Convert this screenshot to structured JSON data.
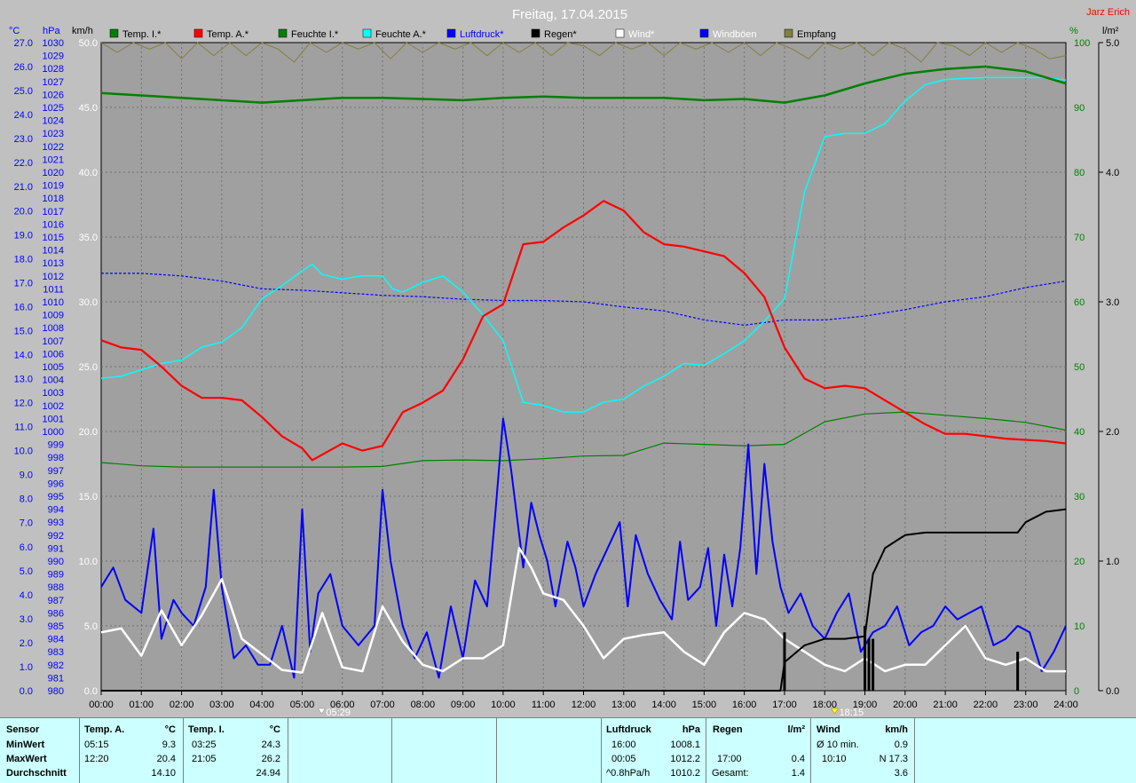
{
  "title": "Freitag, 17.04.2015",
  "author": "Jarz Erich",
  "legend": [
    {
      "label": "Temp. I.*",
      "color": "#008000",
      "text_color": "#000000"
    },
    {
      "label": "Temp. A.*",
      "color": "#ff0000",
      "text_color": "#000000"
    },
    {
      "label": "Feuchte I.*",
      "color": "#008000",
      "text_color": "#000000"
    },
    {
      "label": "Feuchte A.*",
      "color": "#00ffff",
      "text_color": "#000000"
    },
    {
      "label": "Luftdruck*",
      "color": "#0000ff",
      "text_color": "#0000ff"
    },
    {
      "label": "Regen*",
      "color": "#000000",
      "text_color": "#000000"
    },
    {
      "label": "Wind*",
      "color": "#ffffff",
      "text_color": "#ffffff"
    },
    {
      "label": "Windböen",
      "color": "#0000ff",
      "text_color": "#ffffff"
    },
    {
      "label": "Empfang",
      "color": "#808040",
      "text_color": "#000000"
    }
  ],
  "axis_units": {
    "celsius": "°C",
    "hpa": "hPa",
    "kmh": "km/h",
    "percent": "%",
    "rain": "l/m²"
  },
  "axes": {
    "celsius": [
      "27.0",
      "26.0",
      "25.0",
      "24.0",
      "23.0",
      "22.0",
      "21.0",
      "20.0",
      "19.0",
      "18.0",
      "17.0",
      "16.0",
      "15.0",
      "14.0",
      "13.0",
      "12.0",
      "11.0",
      "10.0",
      "9.0",
      "8.0",
      "7.0",
      "6.0",
      "5.0",
      "4.0",
      "3.0",
      "2.0",
      "1.0",
      "0.0"
    ],
    "hpa": [
      "1030",
      "1029",
      "1028",
      "1027",
      "1026",
      "1025",
      "1024",
      "1023",
      "1022",
      "1021",
      "1020",
      "1019",
      "1018",
      "1017",
      "1016",
      "1015",
      "1014",
      "1013",
      "1012",
      "1011",
      "1010",
      "1009",
      "1008",
      "1007",
      "1006",
      "1005",
      "1004",
      "1003",
      "1002",
      "1001",
      "1000",
      "999",
      "998",
      "997",
      "996",
      "995",
      "994",
      "993",
      "992",
      "991",
      "990",
      "989",
      "988",
      "987",
      "986",
      "985",
      "984",
      "983",
      "982",
      "981",
      "980"
    ],
    "kmh": [
      "50.0",
      "45.0",
      "40.0",
      "35.0",
      "30.0",
      "25.0",
      "20.0",
      "15.0",
      "10.0",
      "5.0",
      "0.0"
    ],
    "percent": [
      "100",
      "90",
      "80",
      "70",
      "60",
      "50",
      "40",
      "30",
      "20",
      "10",
      "0"
    ],
    "rain": [
      "5.0",
      "4.0",
      "3.0",
      "2.0",
      "1.0",
      "0.0"
    ],
    "time": [
      "00:00",
      "01:00",
      "02:00",
      "03:00",
      "04:00",
      "05:00",
      "06:00",
      "07:00",
      "08:00",
      "09:00",
      "10:00",
      "11:00",
      "12:00",
      "13:00",
      "14:00",
      "15:00",
      "16:00",
      "17:00",
      "18:00",
      "19:00",
      "20:00",
      "21:00",
      "22:00",
      "23:00",
      "24:00"
    ]
  },
  "sunrise": "05:29",
  "sunset": "18:15",
  "chart_data": {
    "type": "line",
    "x_unit": "hours",
    "xlim": [
      0,
      24
    ],
    "series": [
      {
        "name": "Temp. I.*",
        "axis": "°C",
        "color": "#008000",
        "x": [
          0,
          1,
          2,
          3,
          4,
          5,
          6,
          7,
          8,
          9,
          10,
          11,
          12,
          13,
          14,
          15,
          16,
          17,
          18,
          19,
          20,
          21,
          22,
          23,
          24
        ],
        "y": [
          24.9,
          24.8,
          24.7,
          24.6,
          24.5,
          24.6,
          24.7,
          24.7,
          24.65,
          24.6,
          24.7,
          24.75,
          24.7,
          24.7,
          24.7,
          24.6,
          24.65,
          24.5,
          24.8,
          25.3,
          25.7,
          25.9,
          26.0,
          25.8,
          25.3
        ]
      },
      {
        "name": "Temp. A.*",
        "axis": "°C",
        "color": "#ff0000",
        "x": [
          0,
          0.5,
          1,
          1.5,
          2,
          2.5,
          3,
          3.5,
          4,
          4.5,
          5,
          5.25,
          6,
          6.5,
          7,
          7.5,
          8,
          8.5,
          9,
          9.5,
          10,
          10.5,
          11,
          11.5,
          12,
          12.5,
          13,
          13.5,
          14,
          14.5,
          15,
          15.5,
          16,
          16.5,
          17,
          17.5,
          18,
          18.5,
          19,
          19.5,
          20,
          20.5,
          21,
          21.5,
          22,
          22.5,
          23,
          23.5,
          24
        ],
        "y": [
          14.6,
          14.3,
          14.2,
          13.5,
          12.7,
          12.2,
          12.2,
          12.1,
          11.4,
          10.6,
          10.1,
          9.6,
          10.3,
          10.0,
          10.2,
          11.6,
          12.0,
          12.5,
          13.8,
          15.6,
          16.1,
          18.6,
          18.7,
          19.3,
          19.8,
          20.4,
          20.0,
          19.1,
          18.6,
          18.5,
          18.3,
          18.1,
          17.4,
          16.4,
          14.3,
          13.0,
          12.6,
          12.7,
          12.6,
          12.1,
          11.6,
          11.1,
          10.7,
          10.7,
          10.6,
          10.5,
          10.45,
          10.4,
          10.3
        ]
      },
      {
        "name": "Feuchte I.*",
        "axis": "%",
        "color": "#008000",
        "x": [
          0,
          1,
          2,
          3,
          4,
          5,
          6,
          7,
          8,
          9,
          10,
          11,
          12,
          13,
          14,
          15,
          16,
          17,
          18,
          19,
          20,
          21,
          22,
          23,
          24
        ],
        "y": [
          35.2,
          34.7,
          34.5,
          34.5,
          34.5,
          34.5,
          34.5,
          34.6,
          35.5,
          35.6,
          35.5,
          35.8,
          36.2,
          36.3,
          38.2,
          38.0,
          37.8,
          38.0,
          41.5,
          42.7,
          43.0,
          42.5,
          42.0,
          41.4,
          40.2
        ]
      },
      {
        "name": "Feuchte A.*",
        "axis": "%",
        "color": "#00ffff",
        "x": [
          0,
          0.5,
          1,
          1.5,
          2,
          2.5,
          3,
          3.5,
          4,
          4.5,
          5,
          5.25,
          5.5,
          6,
          6.5,
          7,
          7.25,
          7.5,
          8,
          8.5,
          9,
          9.5,
          10,
          10.5,
          11,
          11.5,
          12,
          12.5,
          13,
          13.5,
          14,
          14.5,
          15,
          15.5,
          16,
          16.5,
          17,
          17.5,
          18,
          18.5,
          19,
          19.5,
          20,
          20.5,
          21,
          21.5,
          22,
          22.5,
          23,
          23.5,
          24
        ],
        "y": [
          48.2,
          48.5,
          49.5,
          50.5,
          51.0,
          53.0,
          53.8,
          56.0,
          60.5,
          62.5,
          64.8,
          65.8,
          64.2,
          63.5,
          64.0,
          64.0,
          62.0,
          61.5,
          63.0,
          64.0,
          61.5,
          58.0,
          54.0,
          44.5,
          44.0,
          43.0,
          43.0,
          44.5,
          45.0,
          47.0,
          48.5,
          50.5,
          50.2,
          52.0,
          54.0,
          57.0,
          60.5,
          77.0,
          85.5,
          86.0,
          86.0,
          87.5,
          91.0,
          93.5,
          94.3,
          94.5,
          94.6,
          94.6,
          94.6,
          94.6,
          94.2
        ]
      },
      {
        "name": "Luftdruck*",
        "axis": "hPa",
        "color": "#0000ff",
        "x": [
          0,
          1,
          2,
          3,
          4,
          5,
          6,
          7,
          8,
          9,
          10,
          11,
          12,
          13,
          14,
          15,
          16,
          17,
          18,
          19,
          20,
          21,
          22,
          23,
          24
        ],
        "y": [
          1012.2,
          1012.2,
          1012.0,
          1011.6,
          1011.0,
          1010.9,
          1010.7,
          1010.5,
          1010.4,
          1010.2,
          1010.1,
          1010.1,
          1010.0,
          1009.6,
          1009.3,
          1008.6,
          1008.2,
          1008.6,
          1008.6,
          1008.9,
          1009.4,
          1010.0,
          1010.4,
          1011.1,
          1011.6
        ]
      },
      {
        "name": "Regen*",
        "axis": "l/m²",
        "color": "#000000",
        "x": [
          0,
          16.9,
          17.0,
          17.5,
          18,
          18.5,
          19,
          19.2,
          19.5,
          20,
          20.5,
          21,
          22,
          22.8,
          23,
          23.5,
          24
        ],
        "y": [
          0,
          0,
          0.22,
          0.35,
          0.4,
          0.4,
          0.42,
          0.9,
          1.1,
          1.2,
          1.22,
          1.22,
          1.22,
          1.22,
          1.3,
          1.38,
          1.4
        ]
      },
      {
        "name": "Wind*",
        "axis": "km/h",
        "color": "#ffffff",
        "x": [
          0,
          0.5,
          1,
          1.5,
          2,
          2.5,
          3,
          3.5,
          4,
          4.5,
          5,
          5.5,
          6,
          6.5,
          7,
          7.5,
          8,
          8.5,
          9,
          9.5,
          10,
          10.4,
          10.7,
          11,
          11.5,
          12,
          12.5,
          13,
          13.5,
          14,
          14.5,
          15,
          15.5,
          16,
          16.5,
          17,
          17.5,
          18,
          18.5,
          19,
          19.5,
          20,
          20.5,
          21,
          21.5,
          22,
          22.5,
          23,
          23.5,
          24
        ],
        "y": [
          4.5,
          4.8,
          2.7,
          6.2,
          3.5,
          5.8,
          8.6,
          4.0,
          2.8,
          1.6,
          1.4,
          6.0,
          1.8,
          1.5,
          6.5,
          3.8,
          2.0,
          1.5,
          2.5,
          2.5,
          3.5,
          11.0,
          9.5,
          7.5,
          7.0,
          5.0,
          2.5,
          4.0,
          4.3,
          4.5,
          3.0,
          2.0,
          4.5,
          6.0,
          5.5,
          4.0,
          3.0,
          2.0,
          1.5,
          2.5,
          1.5,
          2.0,
          2.0,
          3.5,
          5.0,
          2.5,
          2.0,
          2.5,
          1.5,
          1.5
        ]
      },
      {
        "name": "Windböen",
        "axis": "km/h",
        "color": "#0000ff",
        "x": [
          0,
          0.3,
          0.6,
          1,
          1.3,
          1.5,
          1.8,
          2,
          2.3,
          2.6,
          2.8,
          3,
          3.3,
          3.6,
          3.9,
          4.2,
          4.5,
          4.8,
          5,
          5.2,
          5.4,
          5.7,
          6,
          6.4,
          6.8,
          7.0,
          7.2,
          7.5,
          7.8,
          8.1,
          8.4,
          8.7,
          9,
          9.3,
          9.6,
          9.8,
          10,
          10.2,
          10.5,
          10.7,
          10.9,
          11.1,
          11.3,
          11.6,
          11.8,
          12,
          12.3,
          12.6,
          12.9,
          13.1,
          13.3,
          13.6,
          13.9,
          14.2,
          14.4,
          14.6,
          14.9,
          15.1,
          15.3,
          15.5,
          15.7,
          15.9,
          16.1,
          16.3,
          16.5,
          16.7,
          16.9,
          17.1,
          17.4,
          17.7,
          18,
          18.3,
          18.6,
          18.9,
          19.2,
          19.5,
          19.8,
          20.1,
          20.4,
          20.7,
          21,
          21.3,
          21.6,
          21.9,
          22.2,
          22.5,
          22.8,
          23.1,
          23.4,
          23.7,
          24
        ],
        "y": [
          8.0,
          9.5,
          7.0,
          6.0,
          12.5,
          4.0,
          7.0,
          6.0,
          5.0,
          8.0,
          15.5,
          8.0,
          2.5,
          3.5,
          2.0,
          2.0,
          5.0,
          1.0,
          14.0,
          3.0,
          7.5,
          9.0,
          5.0,
          3.5,
          5.0,
          15.5,
          10.0,
          5.0,
          2.5,
          4.5,
          1.0,
          6.5,
          2.5,
          8.5,
          6.5,
          13.5,
          21.0,
          17.0,
          9.5,
          14.5,
          12.0,
          10.0,
          6.5,
          11.5,
          9.5,
          6.5,
          9.0,
          11.0,
          13.0,
          6.5,
          12.0,
          9.0,
          7.0,
          5.5,
          11.5,
          7.0,
          8.0,
          11.0,
          5.0,
          10.5,
          6.5,
          11.0,
          19.0,
          9.0,
          17.5,
          11.5,
          8.0,
          6.0,
          7.5,
          5.0,
          4.0,
          6.0,
          7.5,
          3.0,
          4.5,
          5.0,
          6.5,
          3.5,
          4.5,
          5.0,
          6.5,
          5.5,
          6.0,
          6.5,
          3.5,
          4.0,
          5.0,
          4.5,
          1.5,
          3.0,
          5.0
        ]
      },
      {
        "name": "Empfang",
        "axis": "%",
        "color": "#808040",
        "x": [
          0,
          0.4,
          0.8,
          1.2,
          1.6,
          2,
          2.4,
          2.8,
          3.2,
          3.6,
          4,
          4.4,
          4.8,
          5.2,
          5.6,
          6,
          6.4,
          6.8,
          7.2,
          7.6,
          8,
          8.4,
          8.8,
          9.2,
          9.6,
          10,
          10.4,
          10.8,
          11.2,
          11.6,
          12,
          12.4,
          12.8,
          13.2,
          13.6,
          14,
          14.4,
          14.8,
          15.2,
          15.6,
          16,
          16.4,
          16.8,
          17.2,
          17.6,
          18,
          18.4,
          18.8,
          19.2,
          19.6,
          20,
          20.4,
          20.8,
          21.2,
          21.6,
          22,
          22.4,
          22.8,
          23.2,
          23.6,
          24
        ],
        "y": [
          100,
          98.5,
          100,
          99,
          100,
          97.5,
          100,
          98,
          100,
          98,
          100,
          99,
          97,
          100,
          98.5,
          100,
          99,
          100,
          97.5,
          100,
          98.5,
          100,
          99,
          100,
          98,
          100,
          98.5,
          100,
          98,
          100,
          99.5,
          98,
          100,
          99,
          100,
          98,
          100,
          99,
          100,
          98.5,
          100,
          98,
          100,
          99,
          97.5,
          100,
          99,
          100,
          98,
          100,
          99,
          97,
          100,
          99.5,
          98,
          100,
          98.5,
          100,
          99,
          97.5,
          98
        ]
      }
    ]
  },
  "stats": {
    "sensor_header": "Sensor",
    "row_labels": [
      "MinWert",
      "MaxWert",
      "Durchschnitt"
    ],
    "temp_a": {
      "header": "Temp. A.",
      "unit": "°C",
      "min_time": "05:15",
      "min": "9.3",
      "max_time": "12:20",
      "max": "20.4",
      "avg": "14.10"
    },
    "temp_i": {
      "header": "Temp. I.",
      "unit": "°C",
      "min_time": "03:25",
      "min": "24.3",
      "max_time": "21:05",
      "max": "26.2",
      "avg": "24.94"
    },
    "pressure": {
      "header": "Luftdruck",
      "unit": "hPa",
      "min_time": "16:00",
      "min": "1008.1",
      "max_time": "00:05",
      "max": "1012.2",
      "avg_label": "^0.8hPa/h",
      "avg": "1010.2"
    },
    "rain": {
      "header": "Regen",
      "unit": "l/m²",
      "max_time": "17:00",
      "max": "0.4",
      "total_label": "Gesamt:",
      "total": "1.4"
    },
    "wind": {
      "header": "Wind",
      "unit": "km/h",
      "avg10_label": "Ø 10 min.",
      "avg10": "0.9",
      "max_time": "10:10",
      "max": "N 17.3",
      "avg": "3.6"
    }
  }
}
